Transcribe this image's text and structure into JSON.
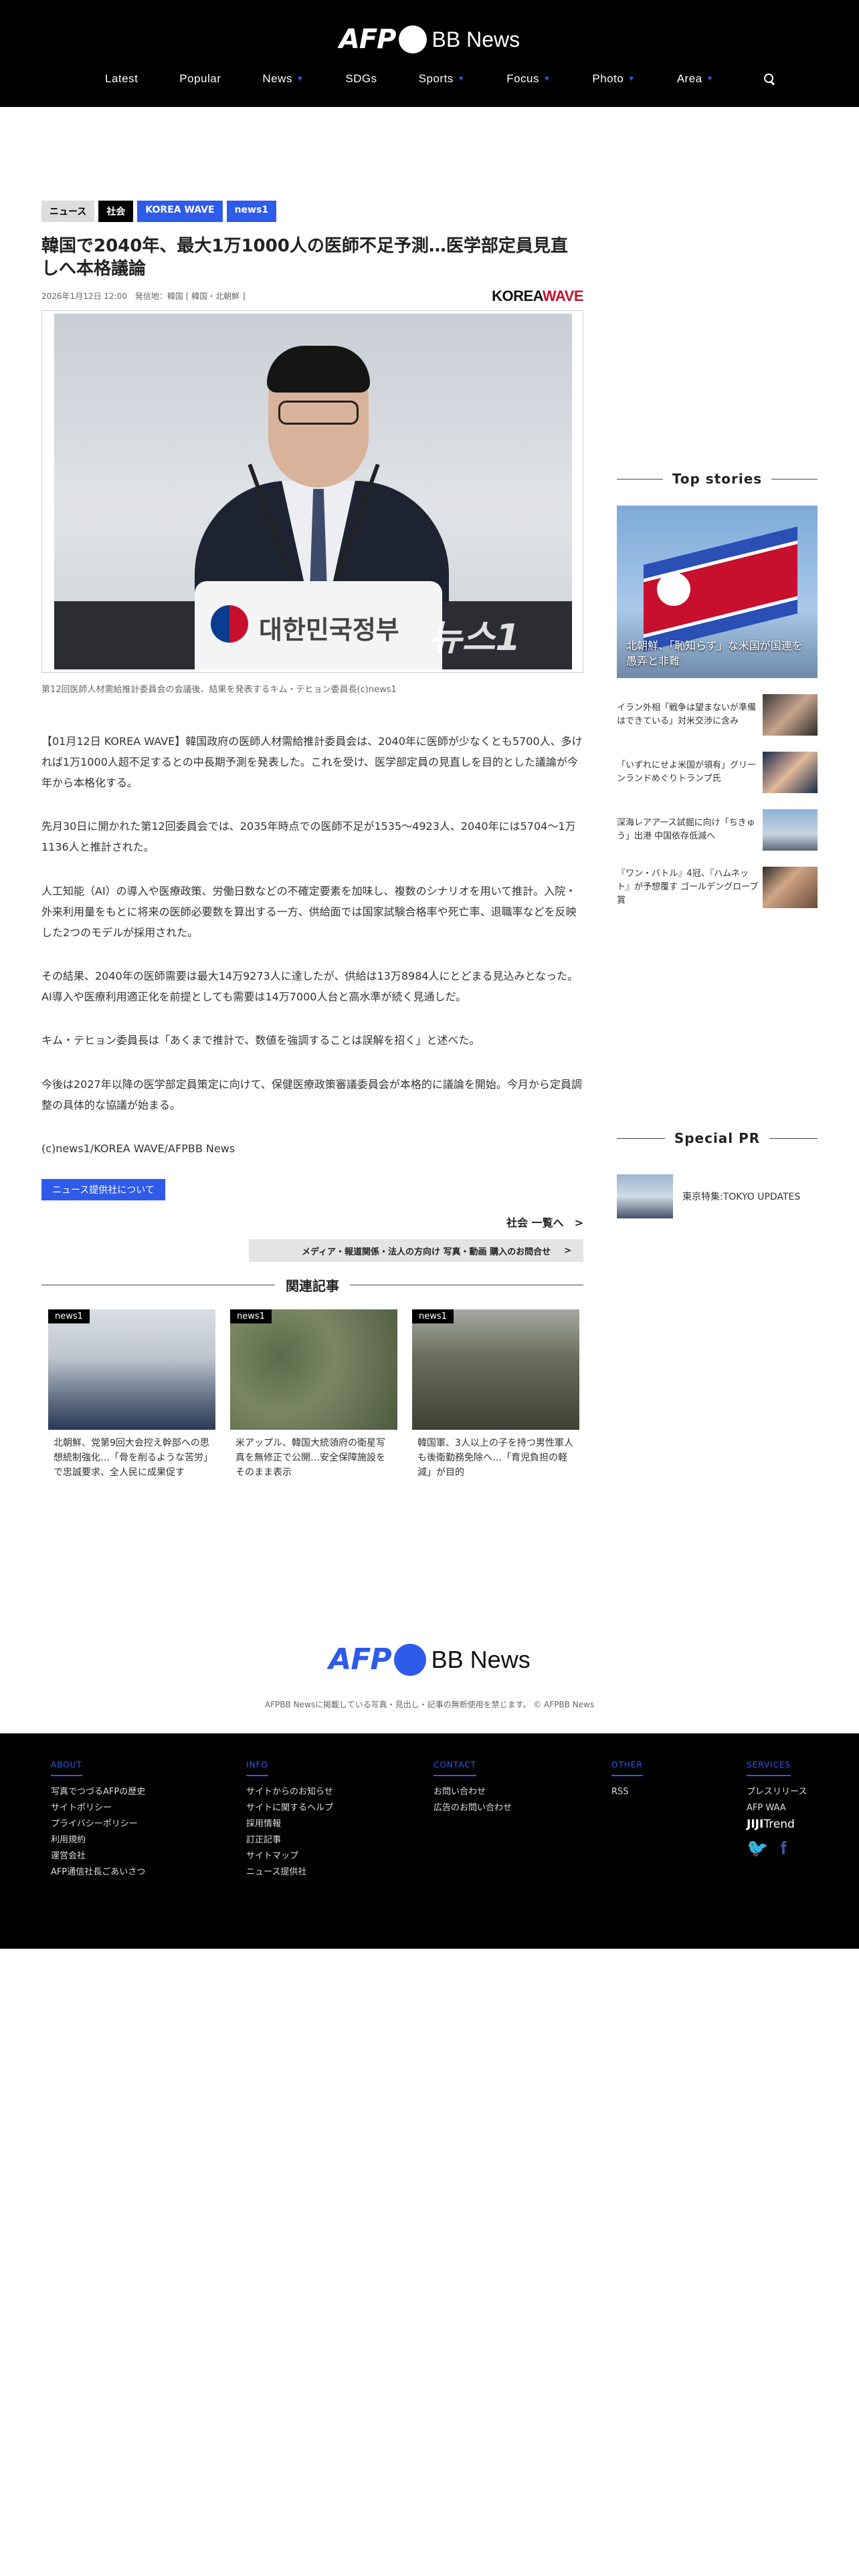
{
  "header": {
    "logo_afp": "AFP",
    "logo_bb": "BB News",
    "nav": [
      {
        "label": "Latest",
        "caret": false
      },
      {
        "label": "Popular",
        "caret": false
      },
      {
        "label": "News",
        "caret": true
      },
      {
        "label": "SDGs",
        "caret": false
      },
      {
        "label": "Sports",
        "caret": true
      },
      {
        "label": "Focus",
        "caret": true
      },
      {
        "label": "Photo",
        "caret": true
      },
      {
        "label": "Area",
        "caret": true
      }
    ]
  },
  "article": {
    "tags": [
      "ニュース",
      "社会",
      "KOREA WAVE",
      "news1"
    ],
    "title": "韓国で2040年、最大1万1000人の医師不足予測…医学部定員見直しへ本格議論",
    "meta": "2026年1月12日 12:00　発信地：韓国 [ 韓国・北朝鮮 ]",
    "source_logo": {
      "a": "KOREA",
      "b": "WAVE"
    },
    "photo_podium_text": "대한민국정부",
    "photo_watermark": "뉴스1",
    "caption": "第12回医師人材需給推計委員会の会議後、結果を発表するキム・テヒョン委員長(c)news1",
    "paragraphs": [
      "【01月12日 KOREA WAVE】韓国政府の医師人材需給推計委員会は、2040年に医師が少なくとも5700人、多ければ1万1000人超不足するとの中長期予測を発表した。これを受け、医学部定員の見直しを目的とした議論が今年から本格化する。",
      "先月30日に開かれた第12回委員会では、2035年時点での医師不足が1535〜4923人、2040年には5704〜1万1136人と推計された。",
      "人工知能（AI）の導入や医療政策、労働日数などの不確定要素を加味し、複数のシナリオを用いて推計。入院・外来利用量をもとに将来の医師必要数を算出する一方、供給面では国家試験合格率や死亡率、退職率などを反映した2つのモデルが採用された。",
      "その結果、2040年の医師需要は最大14万9273人に達したが、供給は13万8984人にとどまる見込みとなった。AI導入や医療利用適正化を前提としても需要は14万7000人台と高水準が続く見通しだ。",
      "キム・テヒョン委員長は「あくまで推計で、数値を強調することは誤解を招く」と述べた。",
      "今後は2027年以降の医学部定員策定に向けて、保健医療政策審議委員会が本格的に議論を開始。今月から定員調整の具体的な協議が始まる。",
      "(c)news1/KOREA WAVE/AFPBB News"
    ],
    "provider_button": "ニュース提供社について",
    "more_link": "社会 一覧へ　>",
    "media_bar": {
      "label": "メディア・報道関係・法人の方向け 写真・動画 購入のお問合せ",
      "arrow": ">"
    }
  },
  "related": {
    "heading": "関連記事",
    "items": [
      {
        "badge": "news1",
        "text": "北朝鮮、党第9回大会控え幹部への思想統制強化…「骨を削るような苦労」で忠誠要求、全人民に成果促す"
      },
      {
        "badge": "news1",
        "text": "米アップル、韓国大統領府の衛星写真を無修正で公開…安全保障施設をそのまま表示"
      },
      {
        "badge": "news1",
        "text": "韓国軍、3人以上の子を持つ男性軍人も後衛勤務免除へ…「育児負担の軽減」が目的"
      }
    ]
  },
  "sidebar": {
    "top_heading": "Top stories",
    "top_caption": "北朝鮮、「恥知らず」な米国が国連を愚弄と非難",
    "items": [
      {
        "text": "イラン外相「戦争は望まないが準備はできている」対米交渉に含み"
      },
      {
        "text": "「いずれにせよ米国が領有」グリーンランドめぐりトランプ氏"
      },
      {
        "text": "深海レアアース試掘に向け「ちきゅう」出港 中国依存低減へ"
      },
      {
        "text": "『ワン・バトル』4冠、『ハムネット』が予想覆す ゴールデングローブ賞"
      }
    ],
    "pr_heading": "Special PR",
    "pr_item": "東京特集:TOKYO UPDATES"
  },
  "footer": {
    "logo_afp": "AFP",
    "logo_bb": "BB News",
    "copyright": "AFPBB Newsに掲載している写真・見出し・記事の無断使用を禁じます。 © AFPBB News",
    "columns": [
      {
        "heading": "ABOUT",
        "items": [
          "写真でつづるAFPの歴史",
          "サイトポリシー",
          "プライバシーポリシー",
          "利用規約",
          "運営会社",
          "AFP通信社長ごあいさつ"
        ]
      },
      {
        "heading": "INFO",
        "items": [
          "サイトからのお知らせ",
          "サイトに関するヘルプ",
          "採用情報",
          "訂正記事",
          "サイトマップ",
          "ニュース提供社"
        ]
      },
      {
        "heading": "CONTACT",
        "items": [
          "お問い合わせ",
          "広告のお問い合わせ"
        ]
      },
      {
        "heading": "OTHER",
        "items": [
          "RSS"
        ]
      },
      {
        "heading": "SERVICES",
        "items": [
          "プレスリリース",
          "AFP WAA"
        ]
      }
    ],
    "jiji": {
      "a": "JIJI",
      "b": "Trend"
    }
  },
  "colors": {
    "accent": "#2f5bea",
    "black": "#000000",
    "kw_red": "#c8102e"
  }
}
